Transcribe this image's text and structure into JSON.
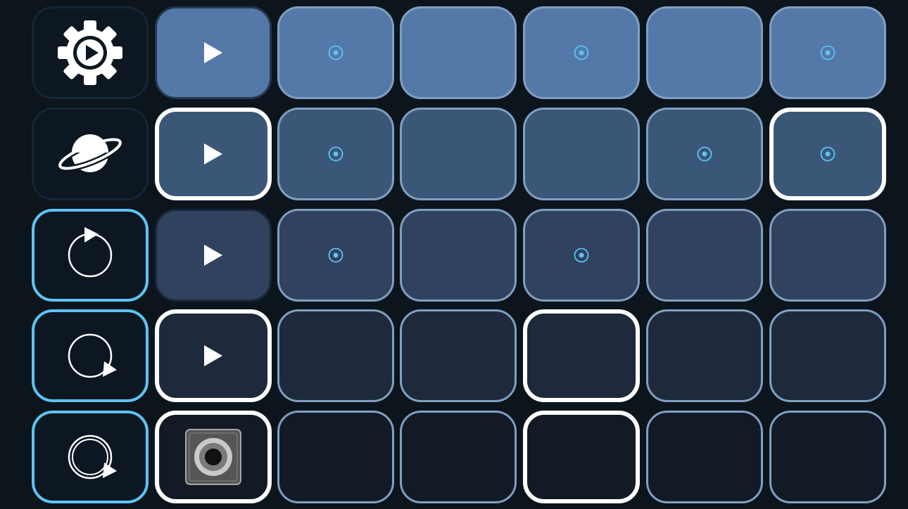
{
  "palette": {
    "row_fills": [
      "#5479a8",
      "#3b5778",
      "#30425e",
      "#1e2a3b",
      "#131a26"
    ],
    "accent": "#5cc4f4",
    "cell_border": "#7f9fc2",
    "selected_border": "#ffffff",
    "background": "#0c141c"
  },
  "rows": [
    {
      "control": {
        "icon": "gear-play-icon",
        "active": false
      },
      "play": {
        "icon": "play-icon",
        "selected": false
      },
      "cells": [
        {
          "marker": true,
          "selected": false
        },
        {
          "marker": false,
          "selected": false
        },
        {
          "marker": true,
          "selected": false
        },
        {
          "marker": false,
          "selected": false
        },
        {
          "marker": true,
          "selected": false
        }
      ]
    },
    {
      "control": {
        "icon": "planet-icon",
        "active": false
      },
      "play": {
        "icon": "play-icon",
        "selected": true
      },
      "cells": [
        {
          "marker": true,
          "selected": false
        },
        {
          "marker": false,
          "selected": false
        },
        {
          "marker": false,
          "selected": false
        },
        {
          "marker": true,
          "selected": false
        },
        {
          "marker": true,
          "selected": true
        }
      ]
    },
    {
      "control": {
        "icon": "loop-top-arrow-icon",
        "active": true
      },
      "play": {
        "icon": "play-icon",
        "selected": false
      },
      "cells": [
        {
          "marker": true,
          "selected": false
        },
        {
          "marker": false,
          "selected": false
        },
        {
          "marker": true,
          "selected": false
        },
        {
          "marker": false,
          "selected": false
        },
        {
          "marker": false,
          "selected": false
        }
      ]
    },
    {
      "control": {
        "icon": "loop-bottom-arrow-icon",
        "active": true
      },
      "play": {
        "icon": "play-icon",
        "selected": true
      },
      "cells": [
        {
          "marker": false,
          "selected": false
        },
        {
          "marker": false,
          "selected": false
        },
        {
          "marker": false,
          "selected": true
        },
        {
          "marker": false,
          "selected": false
        },
        {
          "marker": false,
          "selected": false
        }
      ]
    },
    {
      "control": {
        "icon": "double-loop-arrow-icon",
        "active": true
      },
      "play": {
        "icon": "speaker-icon",
        "selected": true
      },
      "cells": [
        {
          "marker": false,
          "selected": false
        },
        {
          "marker": false,
          "selected": false
        },
        {
          "marker": false,
          "selected": true
        },
        {
          "marker": false,
          "selected": false
        },
        {
          "marker": false,
          "selected": false
        }
      ]
    }
  ]
}
